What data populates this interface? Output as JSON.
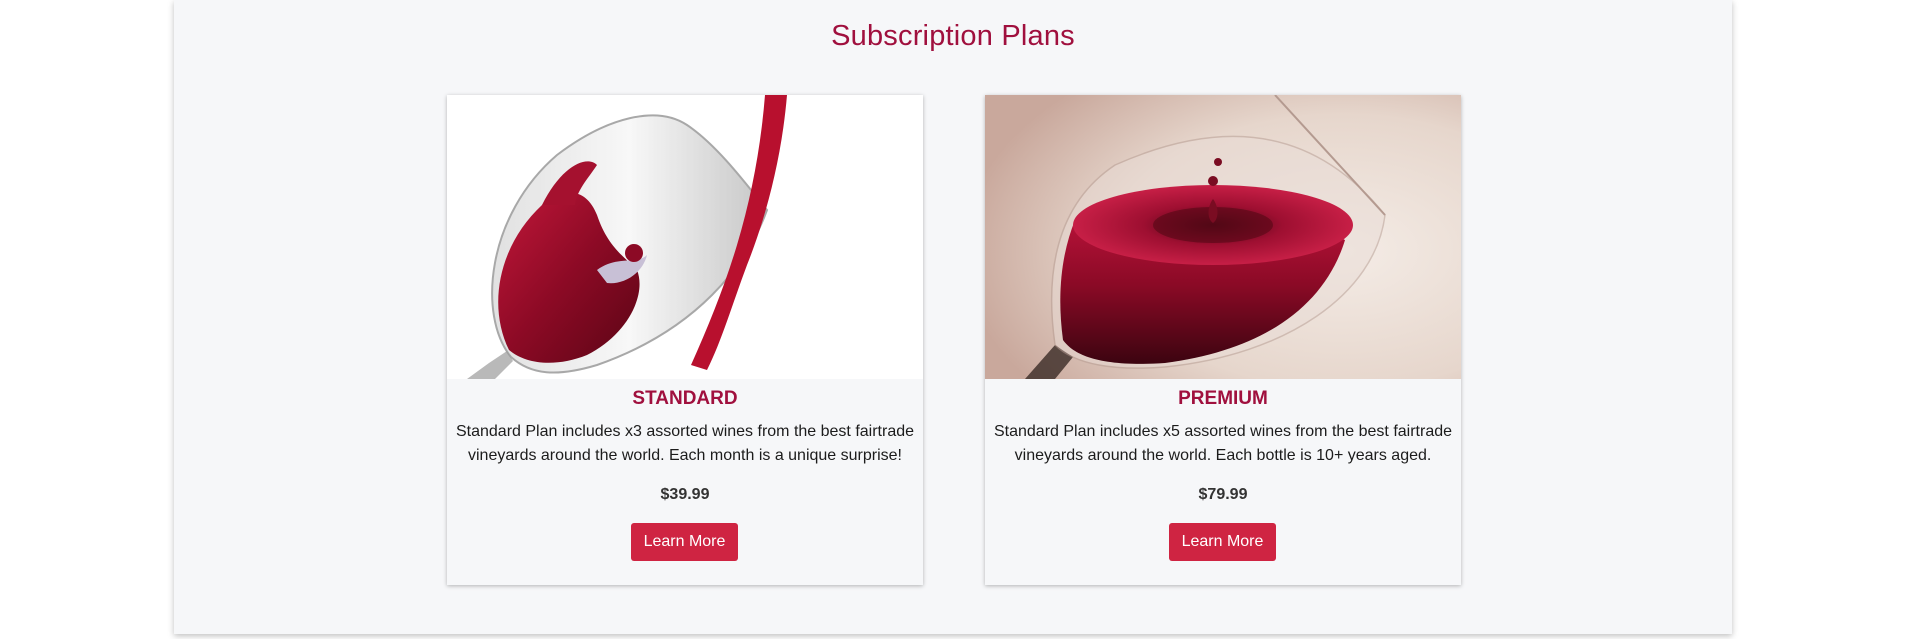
{
  "section": {
    "title": "Subscription Plans"
  },
  "colors": {
    "accent": "#a0103e",
    "button": "#cf2442",
    "panel": "#f6f7f9"
  },
  "plans": [
    {
      "image_icon": "wine-pour-icon",
      "title": "STANDARD",
      "description": "Standard Plan includes x3 assorted wines from the best fairtrade vineyards around the world. Each month is a unique surprise!",
      "price": "$39.99",
      "button_label": "Learn More"
    },
    {
      "image_icon": "wine-glass-drop-icon",
      "title": "PREMIUM",
      "description": "Standard Plan includes x5 assorted wines from the best fairtrade vineyards around the world. Each bottle is 10+ years aged.",
      "price": "$79.99",
      "button_label": "Learn More"
    }
  ]
}
